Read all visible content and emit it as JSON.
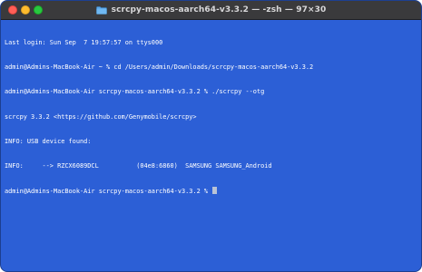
{
  "window": {
    "title": "scrcpy-macos-aarch64-v3.3.2 — -zsh — 97×30",
    "background_color": "#2c5fd6",
    "folder_icon": "folder-icon"
  },
  "terminal": {
    "lines": [
      "Last login: Sun Sep  7 19:57:57 on ttys000",
      "admin@Admins-MacBook-Air ~ % cd /Users/admin/Downloads/scrcpy-macos-aarch64-v3.3.2",
      "admin@Admins-MacBook-Air scrcpy-macos-aarch64-v3.3.2 % ./scrcpy --otg",
      "scrcpy 3.3.2 <https://github.com/Genymobile/scrcpy>",
      "INFO: USB device found:",
      "INFO:     --> RZCX6089DCL          (04e8:6860)  SAMSUNG SAMSUNG_Android",
      "admin@Admins-MacBook-Air scrcpy-macos-aarch64-v3.3.2 % "
    ]
  }
}
